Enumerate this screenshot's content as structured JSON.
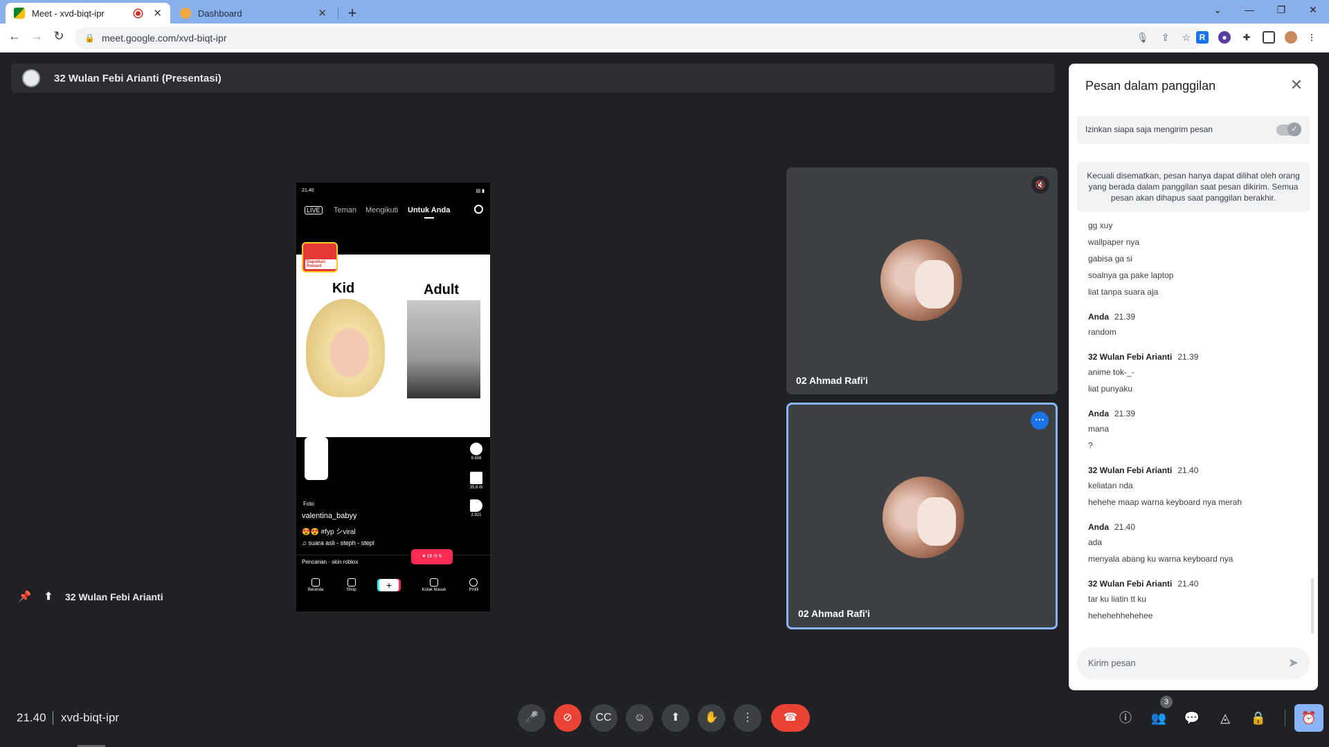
{
  "browser": {
    "tabs": [
      {
        "title": "Meet - xvd-biqt-ipr",
        "active": true,
        "recording": true
      },
      {
        "title": "Dashboard",
        "active": false
      }
    ],
    "url": "meet.google.com/xvd-biqt-ipr"
  },
  "presentation": {
    "banner": "32 Wulan Febi Arianti (Presentasi)",
    "presenter_label": "32 Wulan Febi Arianti"
  },
  "phone": {
    "status_left": "21.40",
    "nav": {
      "live": "LIVE",
      "teman": "Teman",
      "mengikuti": "Mengikuti",
      "untuk_anda": "Untuk Anda"
    },
    "reward": "Dapatkan Reward",
    "kid": "Kid",
    "adult": "Adult",
    "comments": "9.656",
    "saves": "35,8 rb",
    "shares": "2.921",
    "foto": "Foto",
    "username": "valentina_babyy",
    "caption": "😍😍 #fyp シviral",
    "sound": "♫ suara asli - steph - stepl",
    "search": "Pencarian · skin roblox",
    "likes_badge": "♥ 19  ⟲ 5",
    "tabs": [
      "Beranda",
      "Shop",
      "",
      "Kotak Masuk",
      "Profil"
    ]
  },
  "tiles": [
    {
      "name": "02 Ahmad Rafi'i",
      "muted": true
    },
    {
      "name": "02 Ahmad Rafi'i",
      "muted": false
    }
  ],
  "chat": {
    "title": "Pesan dalam panggilan",
    "toggle_label": "Izinkan siapa saja mengirim pesan",
    "info": "Kecuali disematkan, pesan hanya dapat dilihat oleh orang yang berada dalam panggilan saat pesan dikirim. Semua pesan akan dihapus saat panggilan berakhir.",
    "groups": [
      {
        "sender": "",
        "time": "",
        "lines": [
          "gg xuy",
          "wallpaper nya",
          "gabisa ga si",
          "soalnya ga pake laptop",
          "liat tanpa suara aja"
        ]
      },
      {
        "sender": "Anda",
        "time": "21.39",
        "lines": [
          "random"
        ]
      },
      {
        "sender": "32 Wulan Febi Arianti",
        "time": "21.39",
        "lines": [
          "anime tok-_-",
          "liat punyaku"
        ]
      },
      {
        "sender": "Anda",
        "time": "21.39",
        "lines": [
          "mana",
          "?"
        ]
      },
      {
        "sender": "32 Wulan Febi Arianti",
        "time": "21.40",
        "lines": [
          "keliatan nda",
          "hehehe maap warna keyboard nya merah"
        ]
      },
      {
        "sender": "Anda",
        "time": "21.40",
        "lines": [
          "ada",
          "menyala abang ku warna keyboard nya"
        ]
      },
      {
        "sender": "32 Wulan Febi Arianti",
        "time": "21.40",
        "lines": [
          "tar ku liatin tt ku",
          "hehehehhehehee"
        ]
      }
    ],
    "input_placeholder": "Kirim pesan"
  },
  "bottom": {
    "time": "21.40",
    "meeting_code": "xvd-biqt-ipr",
    "participant_count": "3"
  },
  "colors": {
    "accent": "#1a73e8",
    "end_call": "#ea4335",
    "tab_strip": "#8ab0e9"
  }
}
